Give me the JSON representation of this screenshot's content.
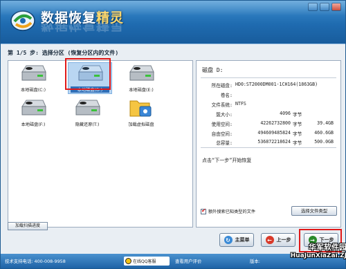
{
  "app": {
    "title": "数据恢复精灵",
    "title_plain": "数据恢复",
    "title_highlight": "精灵"
  },
  "step": {
    "title": "第 1/5 步: 选择分区 (恢复分区内的文件)"
  },
  "drives": [
    {
      "label": "本地磁盘(C:)",
      "icon": "hard-drive-icon",
      "selected": false
    },
    {
      "label": "本地磁盘(D:)",
      "icon": "hard-drive-icon",
      "selected": true
    },
    {
      "label": "本地磁盘(E:)",
      "icon": "hard-drive-icon",
      "selected": false
    },
    {
      "label": "本地磁盘(F:)",
      "icon": "hard-drive-icon",
      "selected": false
    },
    {
      "label": "隐藏还原(T:)",
      "icon": "hard-drive-icon",
      "selected": false
    },
    {
      "label": "加载虚拟磁盘",
      "icon": "virtual-disk-folder-icon",
      "selected": false
    }
  ],
  "load_scan_button": "加载扫描进度",
  "details": {
    "title": "磁盘 D:",
    "rows": [
      {
        "k": "所在磁盘:",
        "v": "HD0:ST2000DM001-1CH164(1863GB)"
      },
      {
        "k": "卷名:",
        "v": ""
      },
      {
        "k": "文件系统:",
        "v": "NTFS"
      },
      {
        "k": "簇大小:",
        "n": "4096",
        "u": "字节",
        "s": ""
      },
      {
        "k": "使用空间:",
        "n": "42262732800",
        "u": "字节",
        "s": "39.4GB"
      },
      {
        "k": "自由空间:",
        "n": "494609485824",
        "u": "字节",
        "s": "460.6GB"
      },
      {
        "k": "总容量:",
        "n": "536872218624",
        "u": "字节",
        "s": "500.0GB"
      }
    ],
    "hint": "点击“下一步”开始恢复",
    "exclude_checkbox_label": "额外搜索已知类型的文件",
    "file_type_button": "选择文件类型"
  },
  "buttons": {
    "main_menu": "主菜单",
    "prev": "上一步",
    "next": "下一步"
  },
  "status": {
    "support": "技术支持电话: 400-008-9958",
    "qq": "在线QQ客服",
    "comments": "查看用户评价",
    "version_label": "版本:"
  },
  "watermark": {
    "line1": "华军软件园",
    "line2": "HuaJunXiaZai.ZJ"
  },
  "colors": {
    "header": "#1f6bb0",
    "selection": "#2f6fb8",
    "annotation_box": "#e01818"
  }
}
